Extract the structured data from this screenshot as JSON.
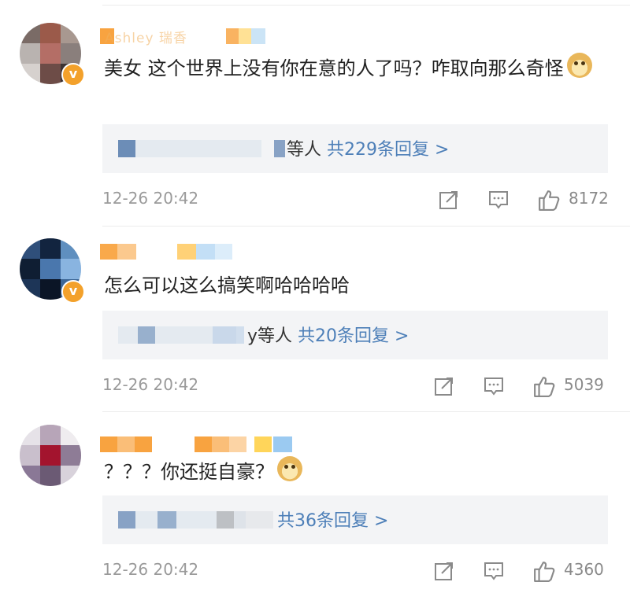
{
  "comments": [
    {
      "username": "Ashley 瑞香",
      "text": "美女 这个世界上没有你在意的人了吗？咋取向那么奇怪",
      "has_doge": true,
      "reply_summary": {
        "suffix": "等人",
        "link": "共229条回复 >"
      },
      "time": "12-26 20:42",
      "likes": "8172",
      "verified": true
    },
    {
      "username": "",
      "text": "怎么可以这么搞笑啊哈哈哈哈",
      "has_doge": false,
      "reply_summary": {
        "suffix": "y等人",
        "link": "共20条回复 >"
      },
      "time": "12-26 20:42",
      "likes": "5039",
      "verified": true
    },
    {
      "username": "",
      "text": "？？？你还挺自豪？",
      "has_doge": true,
      "reply_summary": {
        "suffix": "",
        "link": "共36条回复 >"
      },
      "time": "12-26 20:42",
      "likes": "4360",
      "verified": false
    }
  ],
  "icons": {
    "share": "share-icon",
    "comment": "comment-icon",
    "like": "thumbs-up-icon",
    "verified": "verified-v-badge",
    "emoji": "doge-emoji"
  },
  "colors": {
    "link": "#4d7fb8",
    "reply_bg": "#f3f4f6",
    "meta": "#9a9a9a",
    "badge": "#f3a12b"
  }
}
